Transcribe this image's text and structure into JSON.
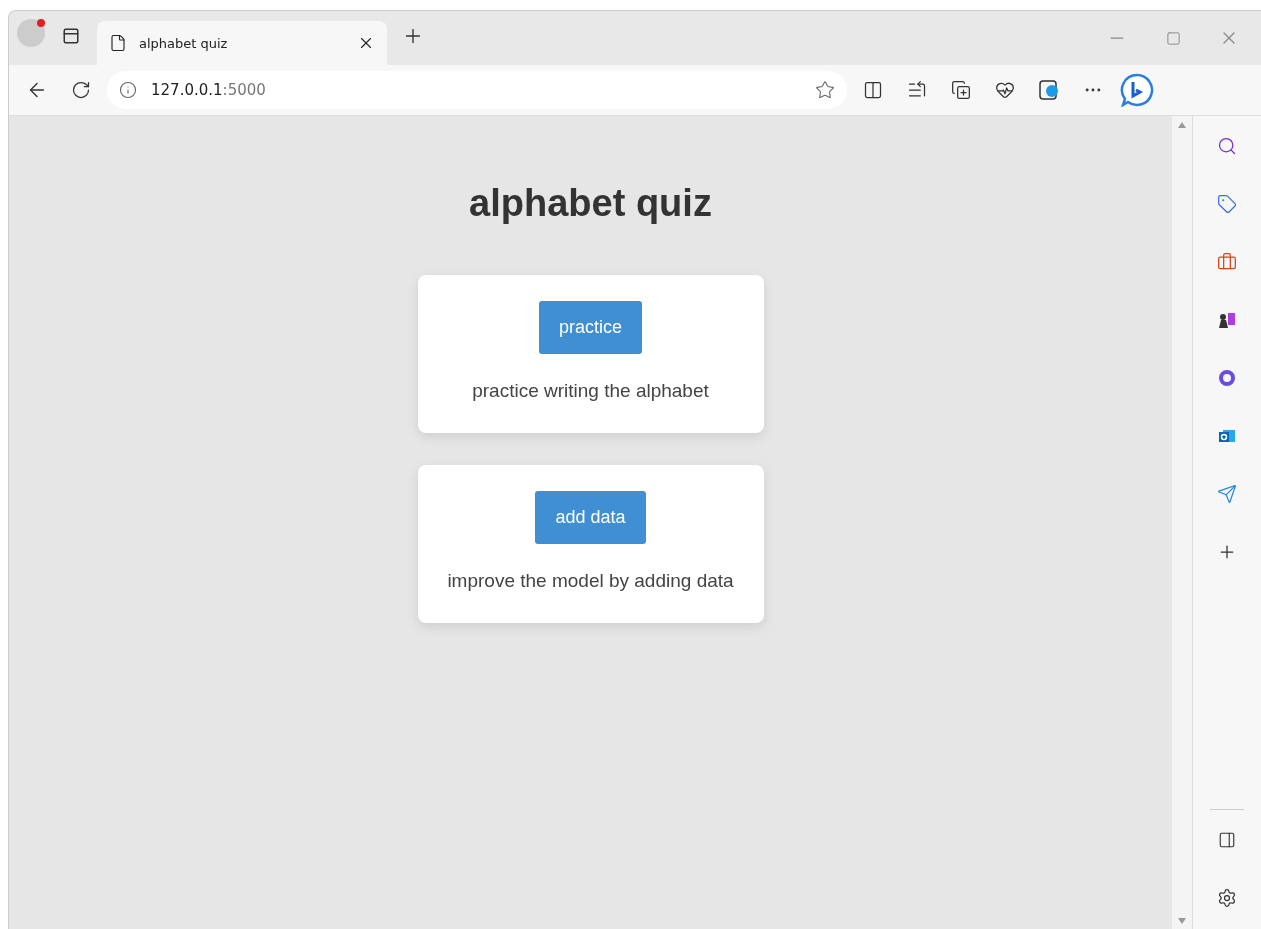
{
  "browser": {
    "tab": {
      "title": "alphabet quiz",
      "selected": true
    },
    "address": {
      "host": "127.0.0.1",
      "port": ":5000"
    }
  },
  "page": {
    "title": "alphabet quiz",
    "cards": [
      {
        "button": "practice",
        "description": "practice writing the alphabet"
      },
      {
        "button": "add data",
        "description": "improve the model by adding data"
      }
    ]
  }
}
